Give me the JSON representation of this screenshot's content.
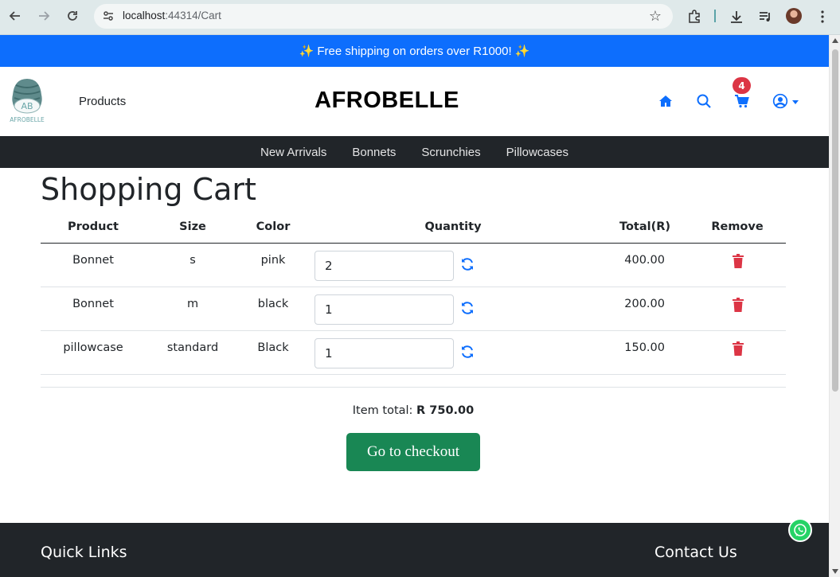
{
  "browser": {
    "url_host": "localhost",
    "url_rest": ":44314/Cart"
  },
  "promo": {
    "text": "✨ Free shipping on orders over R1000! ✨"
  },
  "header": {
    "logo_text_top": "AB",
    "logo_text_bottom": "AFROBELLE",
    "products_link": "Products",
    "brand": "AFROBELLE",
    "cart_count": "4",
    "icons": [
      "home-icon",
      "search-icon",
      "cart-icon",
      "user-icon"
    ]
  },
  "category_nav": [
    "New Arrivals",
    "Bonnets",
    "Scrunchies",
    "Pillowcases"
  ],
  "page_title": "Shopping Cart",
  "table": {
    "headers": [
      "Product",
      "Size",
      "Color",
      "Quantity",
      "Total(R)",
      "Remove"
    ],
    "rows": [
      {
        "product": "Bonnet",
        "size": "s",
        "color": "pink",
        "quantity": "2",
        "total": "400.00"
      },
      {
        "product": "Bonnet",
        "size": "m",
        "color": "black",
        "quantity": "1",
        "total": "200.00"
      },
      {
        "product": "pillowcase",
        "size": "standard",
        "color": "Black",
        "quantity": "1",
        "total": "150.00"
      }
    ]
  },
  "summary": {
    "label": "Item total:",
    "value": "R 750.00"
  },
  "checkout_button": "Go to checkout",
  "footer": {
    "quick_links": "Quick Links",
    "contact_us": "Contact Us"
  },
  "colors": {
    "primary": "#0d6efd",
    "danger": "#dc3545",
    "success": "#198754",
    "dark": "#212529",
    "whatsapp": "#25d366"
  }
}
